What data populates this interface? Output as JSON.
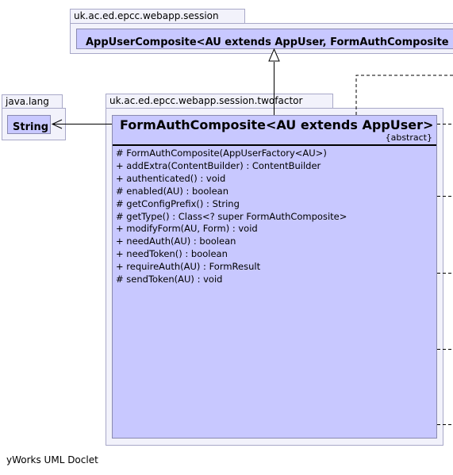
{
  "packages": {
    "session": {
      "name": "uk.ac.ed.epcc.webapp.session",
      "class_name": "AppUserComposite<AU extends AppUser, FormAuthComposite"
    },
    "lang": {
      "name": "java.lang",
      "class_name": "String"
    },
    "twofactor": {
      "name": "uk.ac.ed.epcc.webapp.session.twofactor",
      "class_name": "FormAuthComposite<AU extends AppUser>",
      "stereotype": "{abstract}",
      "members": [
        "# FormAuthComposite(AppUserFactory<AU>)",
        "+ addExtra(ContentBuilder) : ContentBuilder",
        "+ authenticated() : void",
        "# enabled(AU) : boolean",
        "# getConfigPrefix() : String",
        "# getType() : Class<? super FormAuthComposite>",
        "+ modifyForm(AU, Form) : void",
        "+ needAuth(AU) : boolean",
        "+ needToken() : boolean",
        "+ requireAuth(AU) : FormResult",
        "# sendToken(AU) : void"
      ]
    }
  },
  "footer": "yWorks UML Doclet",
  "colors": {
    "package_fill": "#f2f2fb",
    "package_border": "#a8a8c8",
    "class_fill": "#c8c8ff",
    "class_border": "#8a8ab0"
  }
}
